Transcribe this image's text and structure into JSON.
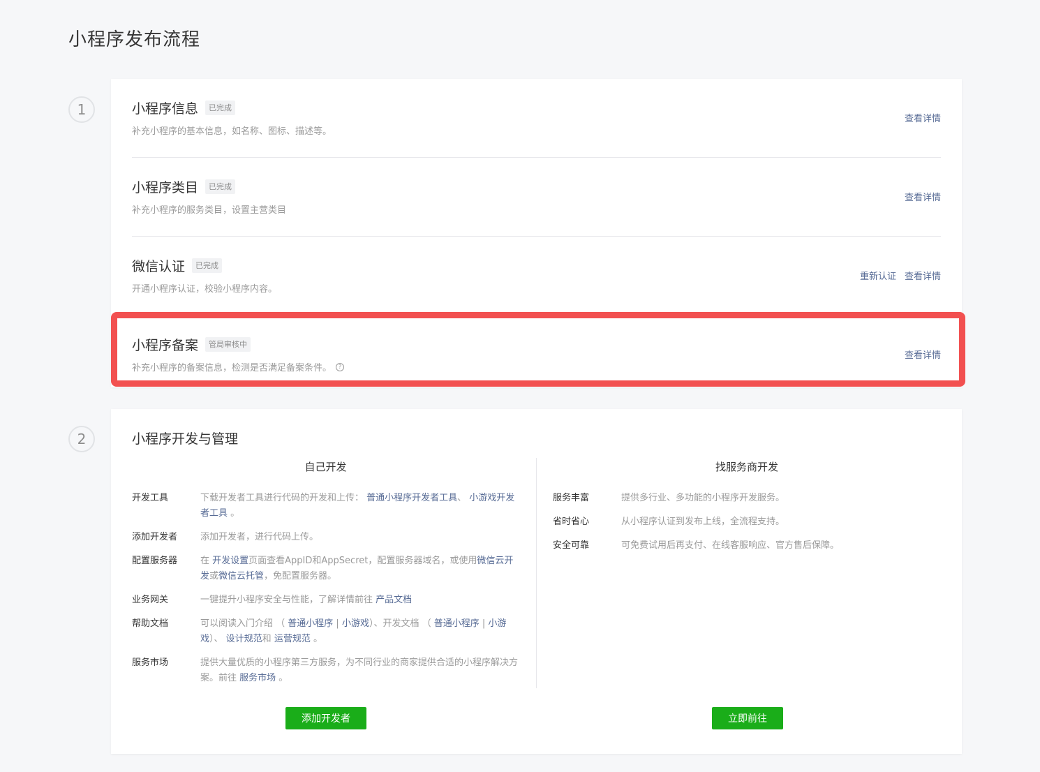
{
  "page_title": "小程序发布流程",
  "steps": [
    "1",
    "2"
  ],
  "publish_steps": [
    {
      "title": "小程序信息",
      "status": "已完成",
      "desc": "补充小程序的基本信息，如名称、图标、描述等。",
      "actions": [
        "查看详情"
      ]
    },
    {
      "title": "小程序类目",
      "status": "已完成",
      "desc": "补充小程序的服务类目，设置主营类目",
      "actions": [
        "查看详情"
      ]
    },
    {
      "title": "微信认证",
      "status": "已完成",
      "desc": "开通小程序认证，校验小程序内容。",
      "actions": [
        "重新认证",
        "查看详情"
      ]
    },
    {
      "title": "小程序备案",
      "status": "管局审核中",
      "desc": "补充小程序的备案信息，检测是否满足备案条件。",
      "help_icon": "?",
      "actions": [
        "查看详情"
      ]
    }
  ],
  "dev": {
    "title": "小程序开发与管理",
    "self": {
      "heading": "自己开发",
      "items": [
        {
          "label": "开发工具",
          "parts": [
            "下载开发者工具进行代码的开发和上传： ",
            "普通小程序开发者工具",
            "、 ",
            "小游戏开发者工具",
            " 。"
          ]
        },
        {
          "label": "添加开发者",
          "parts": [
            "添加开发者，进行代码上传。"
          ]
        },
        {
          "label": "配置服务器",
          "parts": [
            "在 ",
            "开发设置",
            "页面查看AppID和AppSecret，配置服务器域名，或使用",
            "微信云开发",
            "或",
            "微信云托管",
            "，免配置服务器。"
          ]
        },
        {
          "label": "业务网关",
          "parts": [
            "一键提升小程序安全与性能，了解详情前往 ",
            "产品文档"
          ]
        },
        {
          "label": "帮助文档",
          "parts": [
            "可以阅读入门介绍 （ ",
            "普通小程序",
            " | ",
            "小游戏",
            "）、开发文档 （ ",
            "普通小程序",
            " | ",
            "小游戏",
            "）、 ",
            "设计规范",
            "和 ",
            "运营规范",
            " 。"
          ]
        },
        {
          "label": "服务市场",
          "parts": [
            "提供大量优质的小程序第三方服务，为不同行业的商家提供合适的小程序解决方案。前往 ",
            "服务市场",
            " 。"
          ]
        }
      ],
      "button": "添加开发者"
    },
    "provider": {
      "heading": "找服务商开发",
      "items": [
        {
          "label": "服务丰富",
          "text": "提供多行业、多功能的小程序开发服务。"
        },
        {
          "label": "省时省心",
          "text": "从小程序认证到发布上线，全流程支持。"
        },
        {
          "label": "安全可靠",
          "text": "可免费试用后再支付、在线客服响应、官方售后保障。"
        }
      ],
      "button": "立即前往"
    }
  },
  "colors": {
    "link": "#576b95",
    "primary_button": "#1aad19",
    "highlight_border": "#f25050"
  }
}
